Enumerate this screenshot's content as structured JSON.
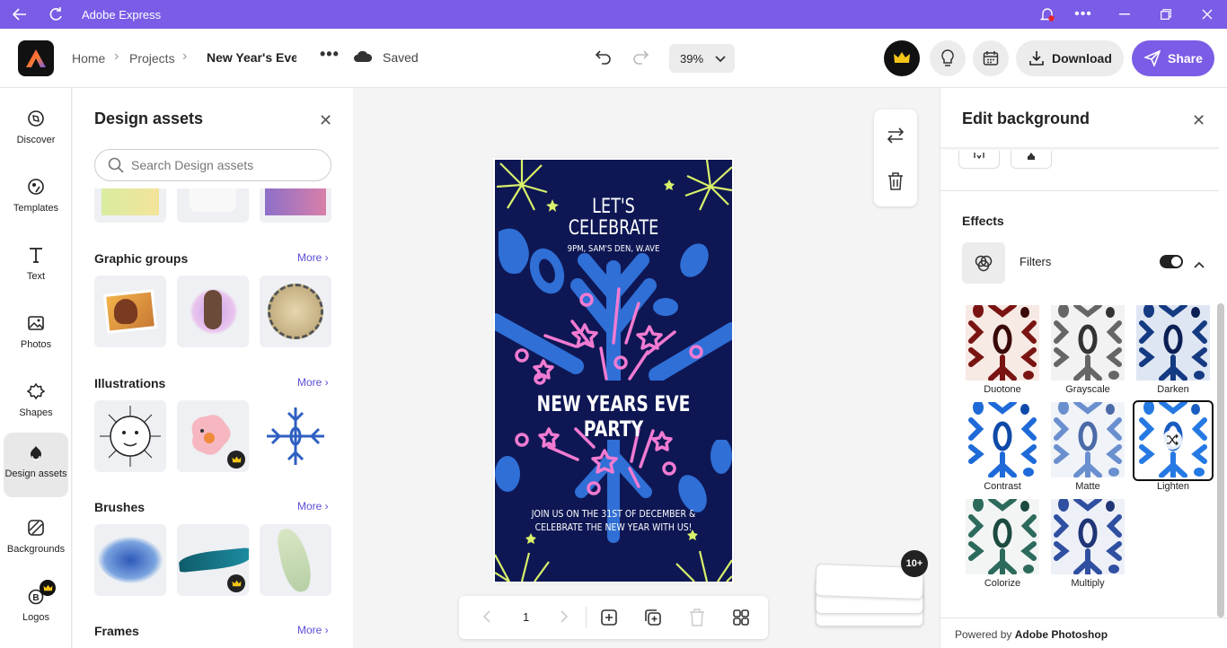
{
  "window": {
    "title": "Adobe Express"
  },
  "breadcrumb": {
    "home": "Home",
    "projects": "Projects",
    "doc_title": "New Year's Eve F"
  },
  "status": {
    "saved": "Saved"
  },
  "toolbar": {
    "zoom": "39%",
    "download": "Download",
    "share": "Share"
  },
  "leftnav": {
    "items": [
      {
        "label": "Discover",
        "icon": "discover-icon"
      },
      {
        "label": "Templates",
        "icon": "templates-icon"
      },
      {
        "label": "Text",
        "icon": "text-icon"
      },
      {
        "label": "Photos",
        "icon": "photos-icon"
      },
      {
        "label": "Shapes",
        "icon": "shapes-icon"
      },
      {
        "label": "Design assets",
        "icon": "design-assets-icon",
        "active": true
      },
      {
        "label": "Backgrounds",
        "icon": "backgrounds-icon"
      },
      {
        "label": "Logos",
        "icon": "logos-icon"
      }
    ]
  },
  "assets_panel": {
    "title": "Design assets",
    "search_placeholder": "Search Design assets",
    "sections": [
      {
        "title": "Graphic groups",
        "more": "More ›"
      },
      {
        "title": "Illustrations",
        "more": "More ›"
      },
      {
        "title": "Brushes",
        "more": "More ›"
      },
      {
        "title": "Frames",
        "more": "More ›"
      }
    ]
  },
  "poster": {
    "line1": "LET'S",
    "line2": "CELEBRATE",
    "line3": "9PM, SAM'S DEN, W.AVE",
    "headline": "NEW YEARS EVE PARTY",
    "body1": "JOIN US ON THE 31ST OF DECEMBER &",
    "body2": "CELEBRATE THE NEW YEAR WITH US!"
  },
  "pagebar": {
    "page": "1"
  },
  "pages_badge": "10+",
  "right_panel": {
    "title": "Edit background",
    "effects": "Effects",
    "filters_label": "Filters",
    "filters_enabled": true,
    "filters": [
      "Duotone",
      "Grayscale",
      "Darken",
      "Contrast",
      "Matte",
      "Lighten",
      "Colorize",
      "Multiply"
    ],
    "selected_filter": "Lighten",
    "footer_prefix": "Powered by ",
    "footer_brand": "Adobe Photoshop"
  },
  "colors": {
    "accent": "#7a5ce6",
    "poster_bg": "#0e1754",
    "poster_blue": "#2f6fd6",
    "poster_pink": "#f17bd2",
    "poster_yellow": "#d9f06a"
  }
}
